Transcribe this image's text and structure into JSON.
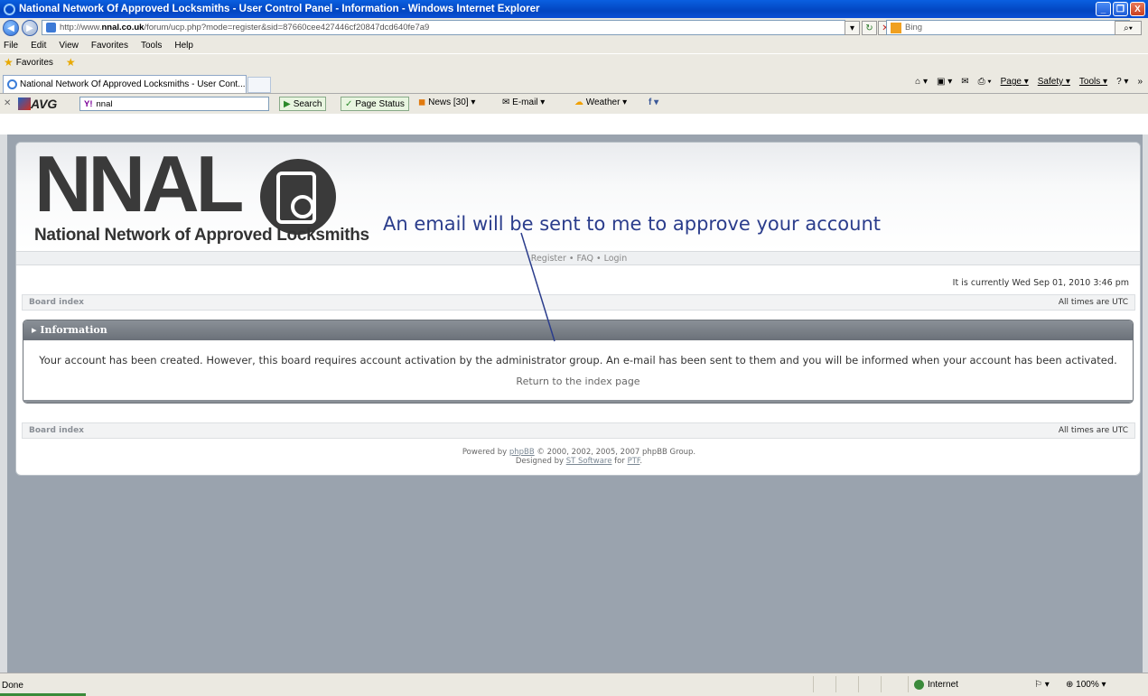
{
  "window": {
    "title": "National Network Of Approved Locksmiths - User Control Panel - Information - Windows Internet Explorer",
    "btn_min": "_",
    "btn_max": "❐",
    "btn_close": "X"
  },
  "browser": {
    "url_prefix": "http://www.",
    "url_domain": "nnal.co.uk",
    "url_rest": "/forum/ucp.php?mode=register&sid=87660cee427446cf20847dcd640fe7a9",
    "search_engine": "Bing",
    "menu": [
      "File",
      "Edit",
      "View",
      "Favorites",
      "Tools",
      "Help"
    ],
    "favorites_label": "Favorites",
    "tab_label": "National Network Of Approved Locksmiths - User Cont...",
    "cmd": {
      "page": "Page ▾",
      "safety": "Safety ▾",
      "tools": "Tools ▾",
      "help": "? ▾",
      "more": "»"
    },
    "avg": {
      "brand": "AVG",
      "query": "nnal",
      "search": "Search",
      "page_status": "Page Status",
      "news": "News [30] ▾",
      "email": "E-mail ▾",
      "weather": "Weather ▾"
    },
    "status": {
      "done": "Done",
      "zone": "Internet",
      "zoom": "100%"
    }
  },
  "site": {
    "logo_main": "NNAL",
    "logo_sub": "National Network of Approved Locksmiths",
    "annotation": "An email will be sent to me to approve your account",
    "nav": "Register  •  FAQ  •  Login",
    "datetime": "It is currently Wed Sep 01, 2010 3:46 pm",
    "breadcrumb": "Board index",
    "timezone": "All times are UTC",
    "info_title": "Information",
    "info_message": "Your account has been created. However, this board requires account activation by the administrator group. An e-mail has been sent to them and you will be informed when your account has been activated.",
    "info_link": "Return to the index page",
    "footer_line1_a": "Powered by ",
    "footer_phpbb": "phpBB",
    "footer_line1_b": " © 2000, 2002, 2005, 2007 phpBB Group.",
    "footer_line2_a": "Designed by ",
    "footer_st": "ST Software",
    "footer_for": " for ",
    "footer_ptf": "PTF",
    "footer_dot": "."
  }
}
